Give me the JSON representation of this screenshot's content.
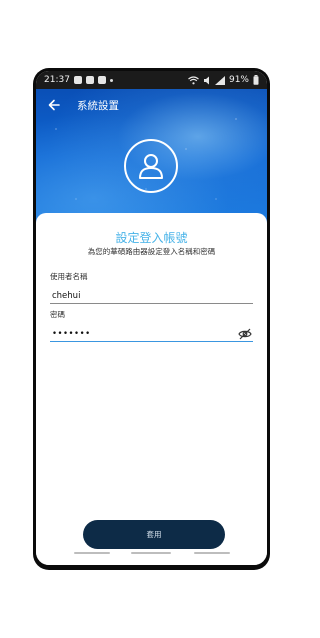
{
  "status_bar": {
    "time": "21:37",
    "battery": "91%"
  },
  "header": {
    "title": "系統設置"
  },
  "form": {
    "title": "設定登入帳號",
    "subtitle": "為您的華碩路由器設定登入名稱和密碼",
    "username_label": "使用者名稱",
    "username_value": "chehui",
    "password_label": "密碼",
    "password_value": "•••••••"
  },
  "actions": {
    "apply_label": "套用"
  },
  "colors": {
    "accent": "#47b3e8",
    "button_bg": "#0d2b47",
    "focus_underline": "#3a96e0"
  },
  "icons": {
    "back": "arrow-left-icon",
    "avatar": "user-icon",
    "visibility": "eye-off-icon"
  }
}
